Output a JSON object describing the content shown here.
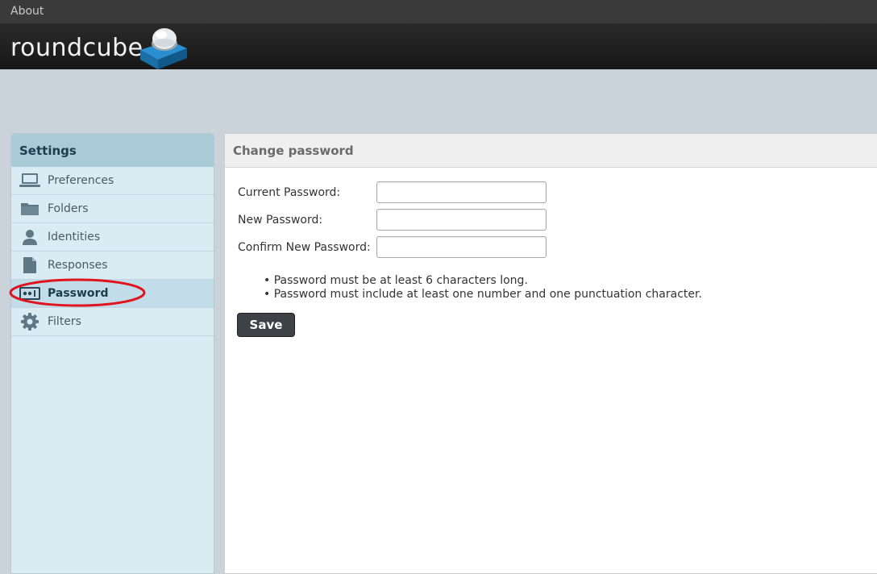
{
  "topbar": {
    "about_label": "About"
  },
  "header": {
    "logo_text": "roundcube"
  },
  "sidebar": {
    "title": "Settings",
    "items": [
      {
        "label": "Preferences",
        "icon": "monitor-icon",
        "selected": false
      },
      {
        "label": "Folders",
        "icon": "folder-icon",
        "selected": false
      },
      {
        "label": "Identities",
        "icon": "person-icon",
        "selected": false
      },
      {
        "label": "Responses",
        "icon": "document-icon",
        "selected": false
      },
      {
        "label": "Password",
        "icon": "password-icon",
        "selected": true
      },
      {
        "label": "Filters",
        "icon": "gear-icon",
        "selected": false
      }
    ]
  },
  "main": {
    "title": "Change password",
    "fields": [
      {
        "label": "Current Password:",
        "value": "",
        "placeholder": ""
      },
      {
        "label": "New Password:",
        "value": "",
        "placeholder": ""
      },
      {
        "label": "Confirm New Password:",
        "value": "",
        "placeholder": ""
      }
    ],
    "rules": [
      "Password must be at least 6 characters long.",
      "Password must include at least one number and one punctuation character."
    ],
    "save_label": "Save"
  },
  "colors": {
    "annotation": "#e0141e",
    "accent": "#1f8ccc",
    "sidebar_bg": "#d9ebf3",
    "sidebar_header": "#a9cad7"
  }
}
